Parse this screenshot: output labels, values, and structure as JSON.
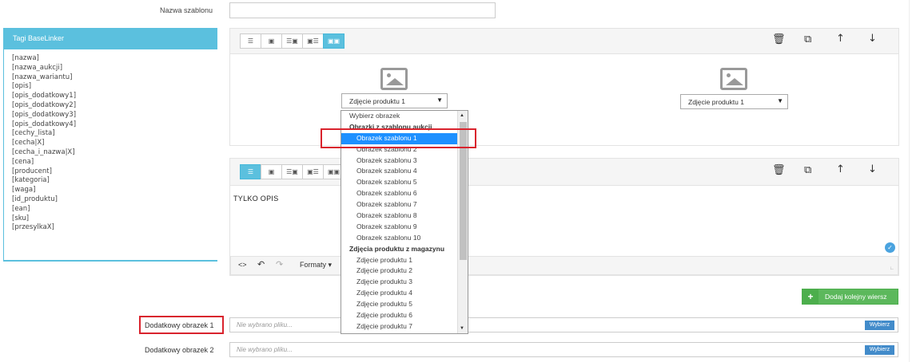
{
  "template_name": {
    "label": "Nazwa szablonu",
    "value": ""
  },
  "sidebar": {
    "title": "Tagi BaseLinker",
    "tags": [
      "[nazwa]",
      "[nazwa_aukcji]",
      "[nazwa_wariantu]",
      "[opis]",
      "[opis_dodatkowy1]",
      "[opis_dodatkowy2]",
      "[opis_dodatkowy3]",
      "[opis_dodatkowy4]",
      "[cechy_lista]",
      "[cecha|X]",
      "[cecha_i_nazwa|X]",
      "[cena]",
      "[producent]",
      "[kategoria]",
      "[waga]",
      "[id_produktu]",
      "[ean]",
      "[sku]",
      "[przesylkaX]"
    ]
  },
  "row1": {
    "select_left": "Zdjęcie produktu 1",
    "select_right": "Zdjęcie produktu 1"
  },
  "dropdown": {
    "options": [
      {
        "text": "Wybierz obrazek",
        "kind": "plain"
      },
      {
        "text": "Obrazki z szablonu aukcji",
        "kind": "group"
      },
      {
        "text": "Obrazek szablonu 1",
        "kind": "selected"
      },
      {
        "text": "Obrazek szablonu 2",
        "kind": "item"
      },
      {
        "text": "Obrazek szablonu 3",
        "kind": "item"
      },
      {
        "text": "Obrazek szablonu 4",
        "kind": "item"
      },
      {
        "text": "Obrazek szablonu 5",
        "kind": "item"
      },
      {
        "text": "Obrazek szablonu 6",
        "kind": "item"
      },
      {
        "text": "Obrazek szablonu 7",
        "kind": "item"
      },
      {
        "text": "Obrazek szablonu 8",
        "kind": "item"
      },
      {
        "text": "Obrazek szablonu 9",
        "kind": "item"
      },
      {
        "text": "Obrazek szablonu 10",
        "kind": "item"
      },
      {
        "text": "Zdjęcia produktu z magazynu",
        "kind": "group"
      },
      {
        "text": "Zdjęcie produktu 1",
        "kind": "item"
      },
      {
        "text": "Zdjęcie produktu 2",
        "kind": "item"
      },
      {
        "text": "Zdjęcie produktu 3",
        "kind": "item"
      },
      {
        "text": "Zdjęcie produktu 4",
        "kind": "item"
      },
      {
        "text": "Zdjęcie produktu 5",
        "kind": "item"
      },
      {
        "text": "Zdjęcie produktu 6",
        "kind": "item"
      },
      {
        "text": "Zdjęcie produktu 7",
        "kind": "item"
      }
    ]
  },
  "editor": {
    "content": "TYLKO OPIS",
    "formats_label": "Formaty"
  },
  "add_row_button": "Dodaj kolejny wiersz",
  "extra_images": [
    {
      "label": "Dodatkowy obrazek 1",
      "placeholder": "Nie wybrano pliku...",
      "button": "Wybierz"
    },
    {
      "label": "Dodatkowy obrazek 2",
      "placeholder": "Nie wybrano pliku...",
      "button": "Wybierz"
    }
  ],
  "colors": {
    "accent": "#5bc0de",
    "green": "#5cb85c",
    "highlight": "#d9232d",
    "selected": "#1e90ff"
  }
}
